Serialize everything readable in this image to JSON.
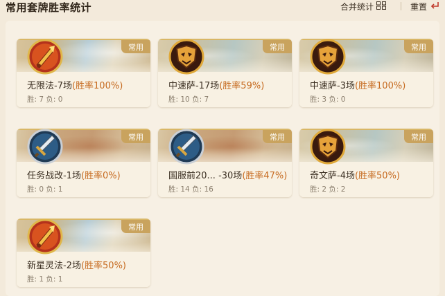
{
  "header": {
    "title": "常用套牌胜率统计",
    "merge_label": "合并统计",
    "reset_label": "重置"
  },
  "decks": [
    {
      "class_icon": "mage-class-icon",
      "badge": "常用",
      "name": "无限法-7场",
      "rate": "(胜率100%)",
      "wins_label": "胜: 7",
      "losses_label": "负: 0"
    },
    {
      "class_icon": "shaman-class-icon",
      "badge": "常用",
      "name": "中速萨-17场",
      "rate": "(胜率59%)",
      "wins_label": "胜: 10",
      "losses_label": "负: 7"
    },
    {
      "class_icon": "shaman-class-icon",
      "badge": "常用",
      "name": "中速萨-3场",
      "rate": "(胜率100%)",
      "wins_label": "胜: 3",
      "losses_label": "负: 0"
    },
    {
      "class_icon": "warrior-class-icon",
      "badge": "常用",
      "name": "任务战改-1场",
      "rate": "(胜率0%)",
      "wins_label": "胜: 0",
      "losses_label": "负: 1"
    },
    {
      "class_icon": "warrior-class-icon",
      "badge": "常用",
      "name": "国服前20... -30场",
      "rate": "(胜率47%)",
      "wins_label": "胜: 14",
      "losses_label": "负: 16"
    },
    {
      "class_icon": "shaman-class-icon",
      "badge": "常用",
      "name": "奇文萨-4场",
      "rate": "(胜率50%)",
      "wins_label": "胜: 2",
      "losses_label": "负: 2"
    },
    {
      "class_icon": "mage-class-icon",
      "badge": "常用",
      "name": "新星灵法-2场",
      "rate": "(胜率50%)",
      "wins_label": "胜: 1",
      "losses_label": "负: 1"
    }
  ],
  "colors": {
    "accent": "#c66a1f",
    "badge": "#c9a35e",
    "background": "#f3eadb"
  }
}
